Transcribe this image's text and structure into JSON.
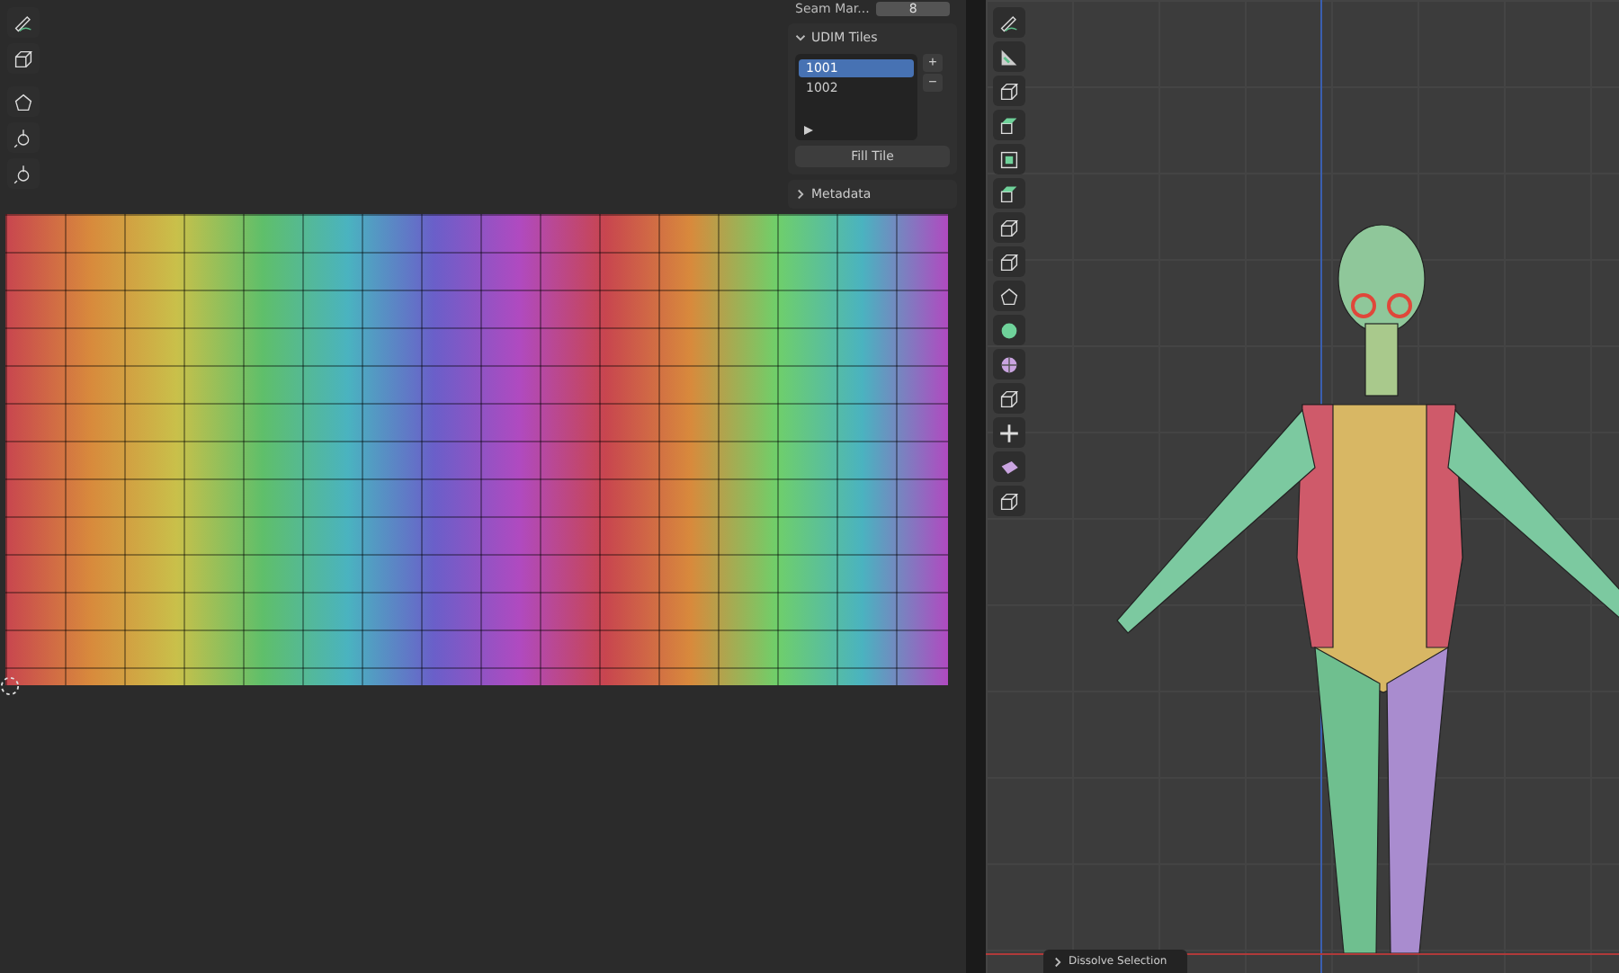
{
  "uv_editor": {
    "sidebar": {
      "seam_field": {
        "label": "Seam Mar...",
        "value": "8"
      },
      "udim_panel": {
        "title": "UDIM Tiles",
        "expanded": true,
        "tiles": [
          {
            "label": "1001",
            "selected": true
          },
          {
            "label": "1002",
            "selected": false
          }
        ],
        "add_button": "+",
        "remove_button": "−",
        "fill_button": "Fill Tile"
      },
      "metadata_panel": {
        "title": "Metadata",
        "expanded": false
      }
    }
  },
  "viewport": {
    "operator_panel": {
      "title": "Dissolve Selection",
      "expanded": false
    }
  }
}
